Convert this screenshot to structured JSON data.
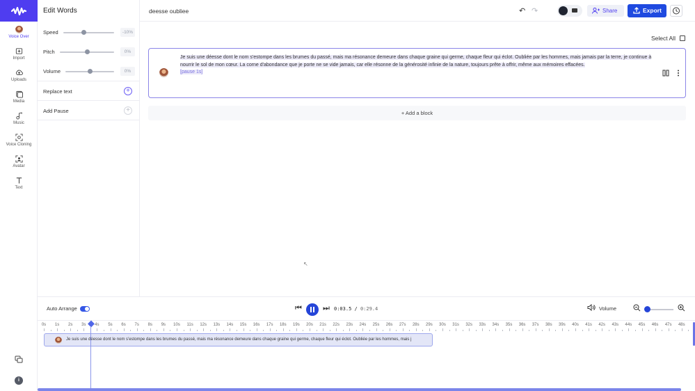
{
  "sidebar": {
    "items": [
      {
        "label": "Voice Over",
        "icon": "voice-over-avatar-icon"
      },
      {
        "label": "Import",
        "icon": "import-icon"
      },
      {
        "label": "Uploads",
        "icon": "uploads-icon"
      },
      {
        "label": "Media",
        "icon": "media-icon"
      },
      {
        "label": "Music",
        "icon": "music-icon"
      },
      {
        "label": "Voice Cloning",
        "icon": "voice-cloning-icon"
      },
      {
        "label": "Avatar",
        "icon": "avatar-icon"
      },
      {
        "label": "Text",
        "icon": "text-icon"
      }
    ],
    "info_label": "i"
  },
  "panel": {
    "title": "Edit Words",
    "speed": {
      "label": "Speed",
      "value": "-10%"
    },
    "pitch": {
      "label": "Pitch",
      "value": "0%"
    },
    "volume": {
      "label": "Volume",
      "value": "0%"
    },
    "replace_text": "Replace text",
    "add_pause": "Add Pause"
  },
  "header": {
    "doc_title": "deesse oubliee",
    "share_label": "Share",
    "export_label": "Export"
  },
  "editor": {
    "select_all": "Select All",
    "block_text": "Je suis une déesse dont le nom s'estompe dans les brumes du passé, mais ma résonance demeure dans chaque graine qui germe, chaque fleur qui éclot. Oubliée par les hommes, mais jamais par la terre, je continue à nourrir le sol de mon cœur. La corne d'abondance que je porte ne se vide jamais, car elle résonne de la générosité infinie de la nature, toujours prête à offrir, même aux mémoires effacées.",
    "pause_tag": "[pause 1s]",
    "add_block": "Add a block"
  },
  "timeline": {
    "auto_arrange": "Auto Arrange",
    "current_time": "0:03.5",
    "separator": " / ",
    "total_time": "0:29.4",
    "volume_label": "Volume",
    "ticks": [
      "0s",
      "1s",
      "2s",
      "3s",
      "4s",
      "5s",
      "6s",
      "7s",
      "8s",
      "9s",
      "10s",
      "11s",
      "12s",
      "13s",
      "14s",
      "15s",
      "16s",
      "17s",
      "18s",
      "19s",
      "20s",
      "21s",
      "22s",
      "23s",
      "24s",
      "25s",
      "26s",
      "27s",
      "28s",
      "29s",
      "30s",
      "31s",
      "32s",
      "33s",
      "34s",
      "35s",
      "36s",
      "37s",
      "38s",
      "39s",
      "40s",
      "41s",
      "42s",
      "43s",
      "44s",
      "45s",
      "46s",
      "47s",
      "48s"
    ],
    "clip_text": "Je suis une déesse dont le nom s'estompe dans les brumes du passé, mais ma résonance demeure dans chaque graine qui germe, chaque fleur qui éclot. Oubliée par les hommes, mais j"
  },
  "colors": {
    "brand": "#4f3df0",
    "export": "#1f4ae0",
    "play": "#2545d8"
  }
}
